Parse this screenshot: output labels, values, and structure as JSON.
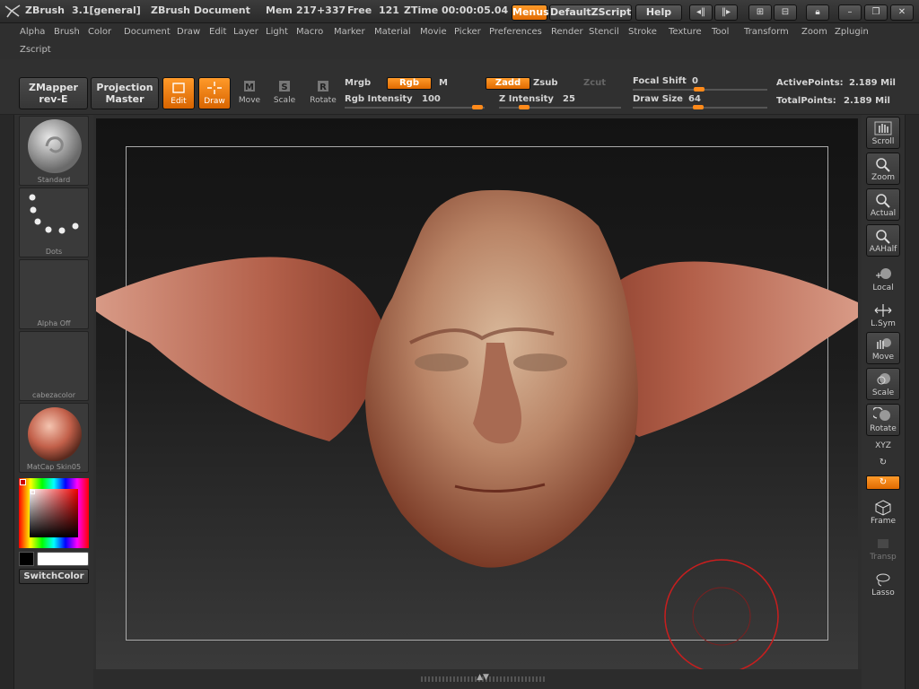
{
  "titlebar": {
    "app_name": "ZBrush",
    "version": "3.1[general]",
    "document": "ZBrush Document",
    "mem_label": "Mem",
    "mem_value": "217+337",
    "free_label": "Free",
    "free_value": "121",
    "ztime_label": "ZTime",
    "ztime_value": "00:00:05.04",
    "menus_button": "Menus",
    "zscript_button": "DefaultZScript",
    "help_button": "Help"
  },
  "menubar": {
    "items": [
      "Alpha",
      "Brush",
      "Color",
      "Document",
      "Draw",
      "Edit",
      "Layer",
      "Light",
      "Macro",
      "Marker",
      "Material",
      "Movie",
      "Picker",
      "Preferences",
      "Render",
      "Stencil",
      "Stroke",
      "Texture",
      "Tool",
      "Transform",
      "Zoom",
      "Zplugin"
    ],
    "second_row": [
      "Zscript"
    ]
  },
  "shelf": {
    "zmapper_line1": "ZMapper",
    "zmapper_line2": "rev-E",
    "projection_line1": "Projection",
    "projection_line2": "Master",
    "edit": "Edit",
    "draw": "Draw",
    "move": "Move",
    "scale": "Scale",
    "rotate": "Rotate",
    "mrgb": "Mrgb",
    "rgb": "Rgb",
    "m": "M",
    "zadd": "Zadd",
    "zsub": "Zsub",
    "zcut": "Zcut",
    "rgb_intensity_label": "Rgb Intensity",
    "rgb_intensity_value": "100",
    "z_intensity_label": "Z Intensity",
    "z_intensity_value": "25",
    "focal_shift_label": "Focal Shift",
    "focal_shift_value": "0",
    "draw_size_label": "Draw Size",
    "draw_size_value": "64",
    "active_points_label": "ActivePoints:",
    "active_points_value": "2.189 Mil",
    "total_points_label": "TotalPoints:",
    "total_points_value": "2.189 Mil"
  },
  "leftpanel": {
    "brush": "Standard",
    "stroke": "Dots",
    "alpha": "Alpha Off",
    "texture": "cabezacolor",
    "material": "MatCap Skin05",
    "switch_color": "SwitchColor"
  },
  "rightpanel": {
    "buttons": [
      "Scroll",
      "Zoom",
      "Actual",
      "AAHalf",
      "Local",
      "L.Sym",
      "Move",
      "Scale",
      "Rotate",
      "XYZ",
      "Frame",
      "Transp",
      "Lasso"
    ]
  },
  "colors": {
    "accent": "#ff8a1a",
    "brush_ring": "#c81e1e"
  }
}
